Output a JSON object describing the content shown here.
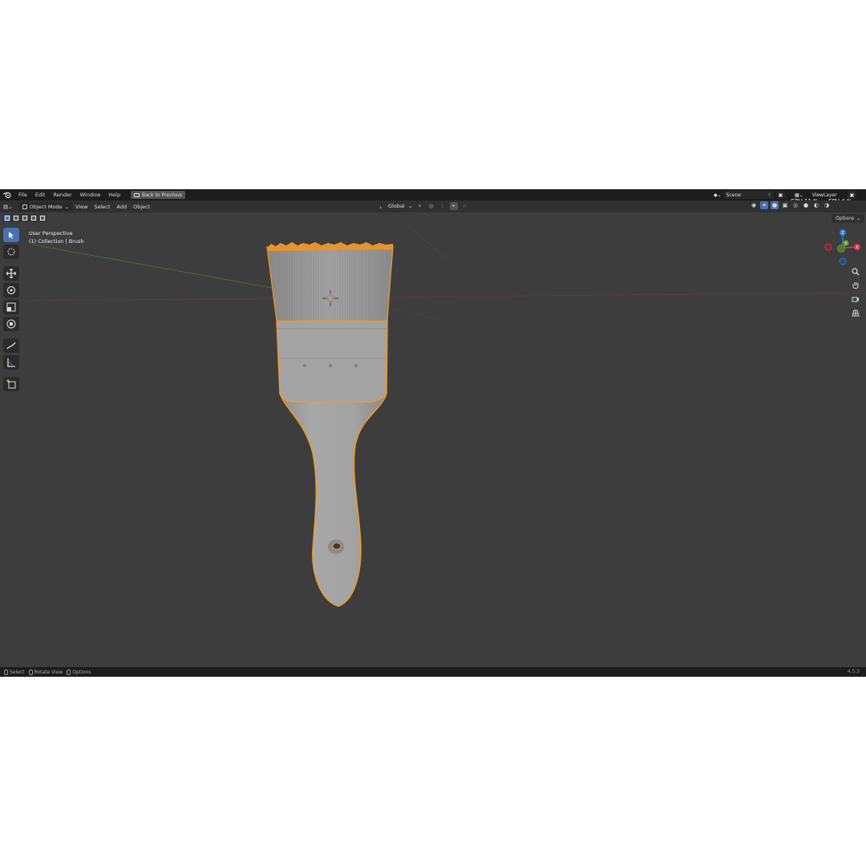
{
  "menu": {
    "items": [
      "File",
      "Edit",
      "Render",
      "Window",
      "Help"
    ],
    "back_button": "Back to Previous"
  },
  "scene": {
    "name": "Scene"
  },
  "view_layer": {
    "name": "ViewLayer"
  },
  "performance": {
    "gpu_label": "GPU",
    "gpu_value": "11 %",
    "cpu_label": "CPU",
    "cpu_value": "4 %"
  },
  "header": {
    "mode": "Object Mode",
    "menus": [
      "View",
      "Select",
      "Add",
      "Object"
    ],
    "orientation": "Global",
    "options_label": "Options"
  },
  "viewport": {
    "perspective": "User Perspective",
    "collection": "(1) Collection | Brush"
  },
  "gizmo": {
    "z_label": "Z",
    "y_label": "Y",
    "x_label": "X"
  },
  "status": {
    "select": "Select",
    "rotate": "Rotate View",
    "options": "Options",
    "version": "4.5.3"
  },
  "colors": {
    "selection_outline": "#f29b21",
    "active_tool": "#4772b3",
    "viewport_bg": "#3d3d3d",
    "axis_x": "#e2394a",
    "axis_y": "#6ca329",
    "axis_z": "#2c7fd6"
  }
}
